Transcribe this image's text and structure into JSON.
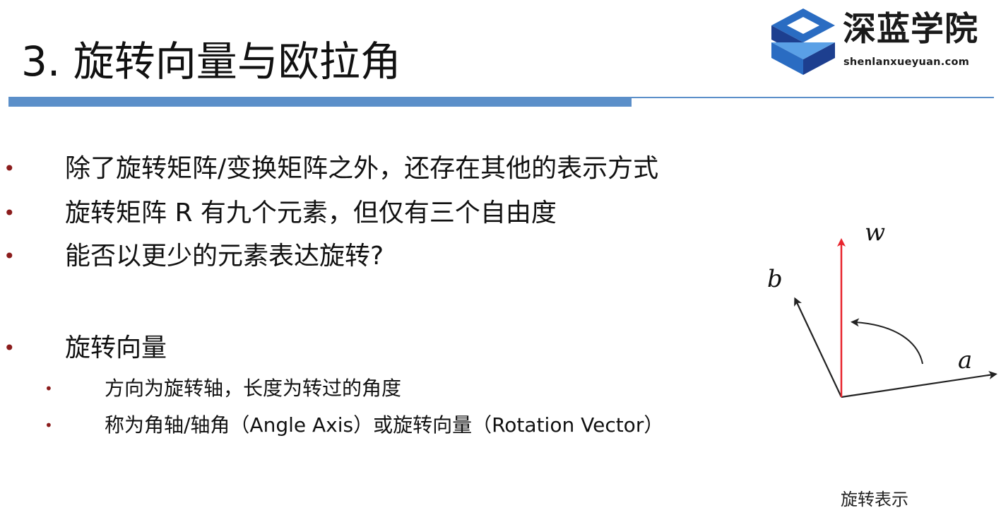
{
  "title": "3. 旋转向量与欧拉角",
  "logo": {
    "name": "深蓝学院",
    "url": "shenlanxueyuan.com",
    "colors": {
      "dark": "#1d3f8f",
      "mid": "#2a6cc2",
      "light": "#5aa0e6"
    }
  },
  "accent_color": "#5b8fc9",
  "bullet_color": "#8b1c1c",
  "bullets": [
    {
      "marker": "•",
      "text": "除了旋转矩阵/变换矩阵之外，还存在其他的表示方式"
    },
    {
      "marker": "•",
      "text": "旋转矩阵 R 有九个元素，但仅有三个自由度"
    },
    {
      "marker": "•",
      "text": "能否以更少的元素表达旋转?"
    },
    {
      "marker": "•",
      "text": "旋转向量"
    }
  ],
  "sub_bullets": [
    {
      "marker": "•",
      "text": "方向为旋转轴，长度为转过的角度"
    },
    {
      "marker": "•",
      "text": "称为角轴/轴角（Angle Axis）或旋转向量（Rotation Vector）"
    }
  ],
  "diagram": {
    "labels": {
      "w": "w",
      "b": "b",
      "a": "a"
    },
    "colors": {
      "w_axis": "#e8252e",
      "axes": "#222222"
    },
    "caption": "旋转表示"
  }
}
